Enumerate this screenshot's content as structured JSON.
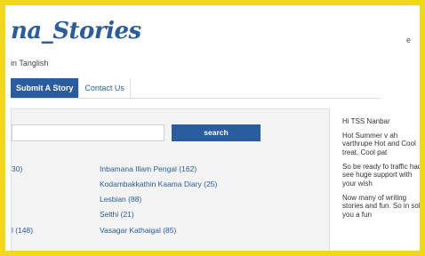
{
  "site": {
    "logo": "na_Stories",
    "tagline": "in Tanglish",
    "header_right": "e"
  },
  "nav": {
    "items": [
      {
        "label": "Submit A Story",
        "active": true
      },
      {
        "label": "Contact Us",
        "active": false
      }
    ]
  },
  "search": {
    "placeholder": "",
    "button_label": "search"
  },
  "categories": {
    "left": [
      "30)",
      "l (148)"
    ],
    "right": [
      "Inbamana Illam Pengal (162)",
      "Kodambakkathin Kaama Diary (25)",
      "Lesbian (88)",
      "Selthi (21)",
      "Vasagar Kathaigal (85)"
    ]
  },
  "sidebar": {
    "paragraphs": [
      "Hi TSS Nanbar",
      "Hot Summer v ah varthrupe Hot and Cool treat. Cool pat",
      "So be ready fo traffic had see huge support with your wish",
      "Now many of writing stories and fun. So in solu you a fun"
    ]
  },
  "colors": {
    "accent": "#2a5d9f",
    "frame": "#f2d81c",
    "panel": "#f3f3f3"
  }
}
